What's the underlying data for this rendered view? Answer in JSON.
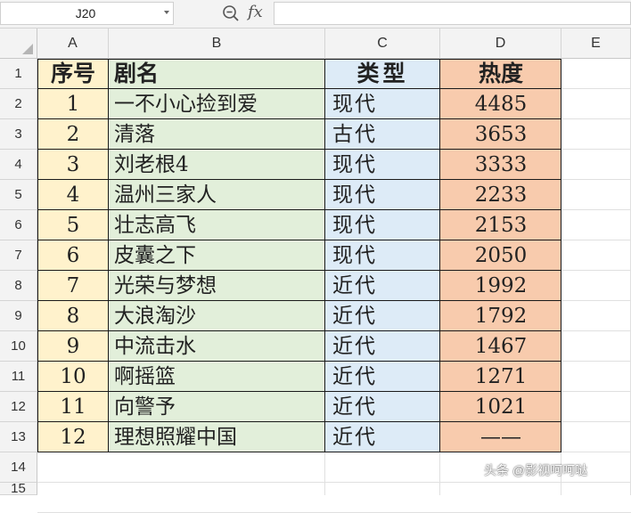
{
  "formula_bar": {
    "name_box": "J20",
    "fx_label": "fx",
    "content": ""
  },
  "columns": [
    "A",
    "B",
    "C",
    "D",
    "E"
  ],
  "row_numbers": [
    "1",
    "2",
    "3",
    "4",
    "5",
    "6",
    "7",
    "8",
    "9",
    "10",
    "11",
    "12",
    "13",
    "14",
    "15"
  ],
  "table": {
    "headers": [
      "序号",
      "剧名",
      "类型",
      "热度"
    ],
    "rows": [
      [
        "1",
        "一不小心捡到爱",
        "现代",
        "4485"
      ],
      [
        "2",
        "清落",
        "古代",
        "3653"
      ],
      [
        "3",
        "刘老根4",
        "现代",
        "3333"
      ],
      [
        "4",
        "温州三家人",
        "现代",
        "2233"
      ],
      [
        "5",
        "壮志高飞",
        "现代",
        "2153"
      ],
      [
        "6",
        "皮囊之下",
        "现代",
        "2050"
      ],
      [
        "7",
        "光荣与梦想",
        "近代",
        "1992"
      ],
      [
        "8",
        "大浪淘沙",
        "近代",
        "1792"
      ],
      [
        "9",
        "中流击水",
        "近代",
        "1467"
      ],
      [
        "10",
        "啊摇篮",
        "近代",
        "1271"
      ],
      [
        "11",
        "向警予",
        "近代",
        "1021"
      ],
      [
        "12",
        "理想照耀中国",
        "近代",
        "——"
      ]
    ]
  },
  "colors": {
    "col_a": "#fff2cc",
    "col_b": "#e2efda",
    "col_c": "#ddebf7",
    "col_d": "#f8cbad"
  },
  "watermark": "头条 @影视呵呵哒"
}
